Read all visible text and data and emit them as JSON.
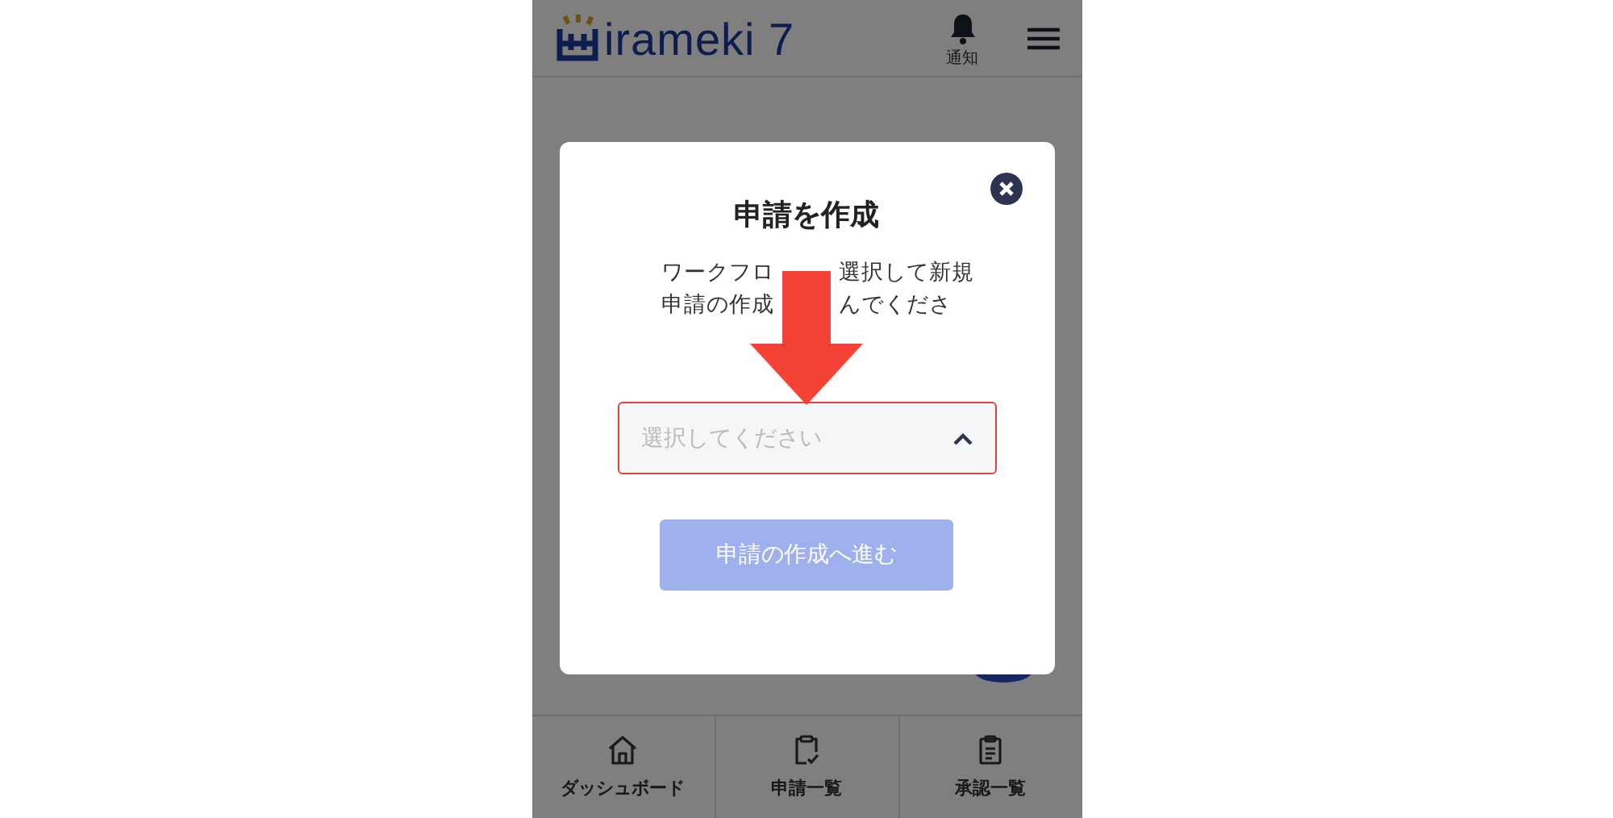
{
  "header": {
    "logo": "irameki 7",
    "notification_label": "通知"
  },
  "dialog": {
    "title": "申請を作成",
    "description_lines": [
      [
        "ワークフロ",
        "選択して新規"
      ],
      [
        "申請の作成",
        "んでくださ"
      ]
    ],
    "select": {
      "placeholder": "選択してください",
      "invalid": true,
      "expanded": true
    },
    "button": {
      "label": "申請の作成へ進む",
      "disabled": true
    }
  },
  "bottom_nav": [
    {
      "label": "ダッシュボード",
      "kind": "home"
    },
    {
      "label": "申請一覧",
      "kind": "clipboard-check"
    },
    {
      "label": "承認一覧",
      "kind": "clipboard-list"
    }
  ]
}
